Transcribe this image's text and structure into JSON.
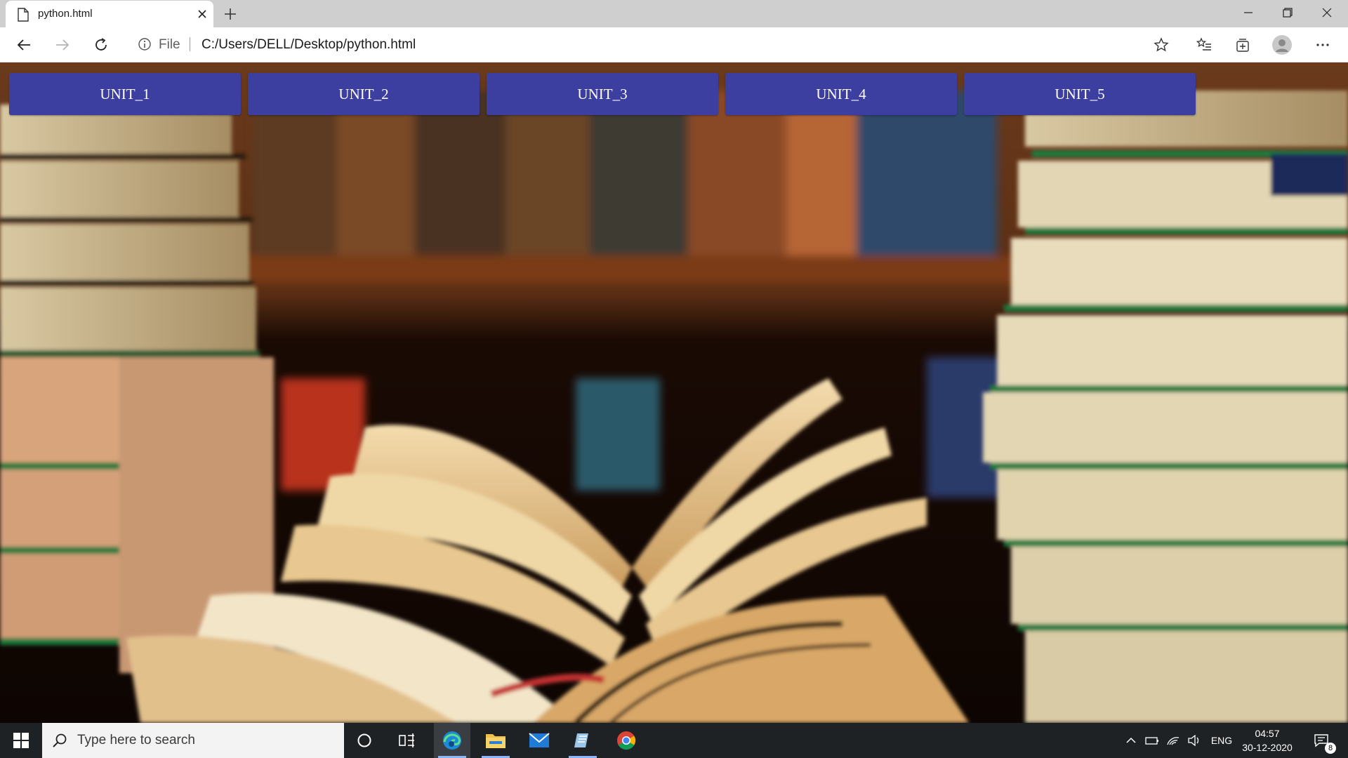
{
  "browser": {
    "tab_title": "python.html",
    "address_scheme": "File",
    "address_url": "C:/Users/DELL/Desktop/python.html"
  },
  "page": {
    "units": [
      {
        "label": "UNIT_1"
      },
      {
        "label": "UNIT_2"
      },
      {
        "label": "UNIT_3"
      },
      {
        "label": "UNIT_4"
      },
      {
        "label": "UNIT_5"
      }
    ],
    "button_color": "#3c3f9f",
    "background_image": "books-library-photo"
  },
  "taskbar": {
    "search_placeholder": "Type here to search",
    "language": "ENG",
    "time": "04:57",
    "date": "30-12-2020",
    "notification_count": "8"
  }
}
